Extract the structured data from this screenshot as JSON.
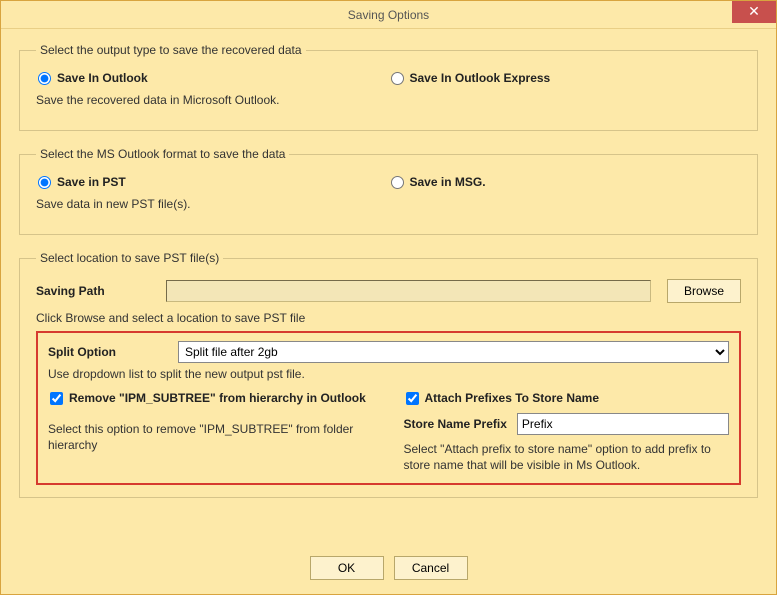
{
  "window": {
    "title": "Saving Options",
    "close_glyph": "✕"
  },
  "output_group": {
    "legend": "Select the output type to save the recovered data",
    "opt_outlook": "Save In Outlook",
    "opt_express": "Save In Outlook Express",
    "desc": "Save the recovered data in Microsoft Outlook."
  },
  "format_group": {
    "legend": "Select the MS Outlook format to save the data",
    "opt_pst": "Save in PST",
    "opt_msg": "Save in MSG.",
    "desc": "Save data in new PST file(s)."
  },
  "location_group": {
    "legend": "Select location to save PST file(s)",
    "path_label": "Saving Path",
    "path_value": "",
    "browse_label": "Browse",
    "browse_hint": "Click Browse and select a location to save PST file",
    "split_label": "Split Option",
    "split_value": "Split file after 2gb",
    "split_hint": "Use dropdown list to split the new output pst file.",
    "remove_ipm_label": "Remove \"IPM_SUBTREE\" from hierarchy in Outlook",
    "remove_ipm_desc": "Select this option to remove \"IPM_SUBTREE\" from folder hierarchy",
    "attach_prefix_label": "Attach Prefixes To Store Name",
    "prefix_field_label": "Store Name Prefix",
    "prefix_value": "Prefix",
    "prefix_desc": "Select \"Attach prefix to store name\" option to add prefix to store name that will be visible in Ms Outlook."
  },
  "buttons": {
    "ok": "OK",
    "cancel": "Cancel"
  }
}
